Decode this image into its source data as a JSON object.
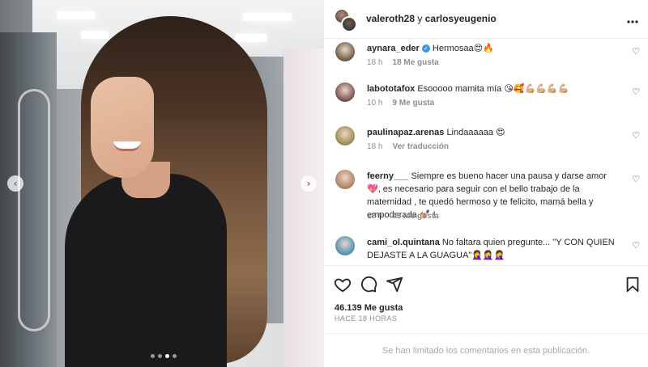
{
  "photo": {
    "nav_prev": "‹",
    "nav_next": "›",
    "carousel": {
      "count": 4,
      "active_index": 2
    }
  },
  "header": {
    "user1": "valeroth28",
    "and": "y",
    "user2": "carlosyeugenio",
    "more_icon": "more-horizontal-icon"
  },
  "comments": [
    {
      "user": "aynara_eder",
      "verified": true,
      "text": "Hermosaa😍🔥",
      "time": "18 h",
      "likes": "18 Me gusta",
      "avatar_color": "#6b5a3e"
    },
    {
      "user": "labototafox",
      "verified": false,
      "text": "Esooooo mamita mía 😘🥰💪🏼💪🏼💪🏼💪🏼",
      "time": "10 h",
      "likes": "9 Me gusta",
      "avatar_color": "#7a4b4b"
    },
    {
      "user": "paulinapaz.arenas",
      "verified": false,
      "text": "Lindaaaaaa 😍",
      "time": "18 h",
      "likes": "Ver traducción",
      "avatar_color": "#9c8a4f"
    },
    {
      "user": "feerny___",
      "verified": false,
      "text": "Siempre es bueno hacer una pausa y darse amor 💖, es necesario para seguir con el bello trabajo de la maternidad , te quedó hermoso y te felicito, mamá bella y empoderada 💅🏻 !",
      "time": "18 h",
      "likes": "75 Me gusta",
      "avatar_color": "#b07e5e"
    },
    {
      "user": "cami_ol.quintana",
      "verified": false,
      "text": "No faltara quien pregunte... \"Y CON QUIEN DEJASTE A LA GUAGUA\"🤦‍♀️🤦‍♀️🤦‍♀️",
      "time": "",
      "likes": "",
      "avatar_color": "#4a90b8"
    }
  ],
  "actions": {
    "likes": "46.139 Me gusta",
    "time_ago": "HACE 18 HORAS"
  },
  "footer": {
    "limited_text": "Se han limitado los comentarios en esta publicación."
  },
  "colors": {
    "verified": "#3897f0",
    "secondary_text": "#8e8e8e",
    "border": "#efefef"
  }
}
